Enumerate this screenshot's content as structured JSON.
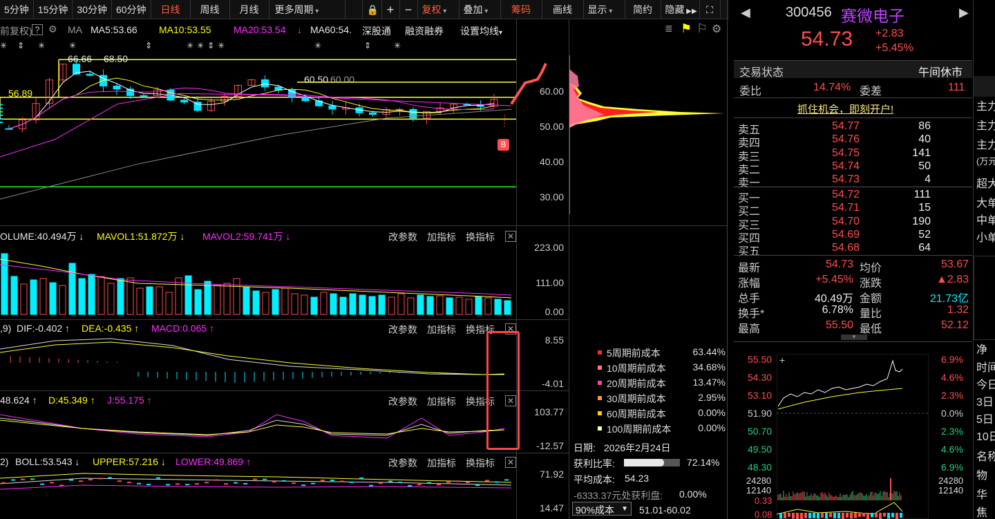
{
  "toolbar": {
    "periods": [
      "5分钟",
      "15分钟",
      "30分钟",
      "60分钟",
      "日线",
      "周线",
      "月线",
      "更多周期"
    ],
    "tools": [
      "复权",
      "叠加",
      "筹码",
      "画线",
      "显示",
      "简约",
      "隐藏"
    ]
  },
  "main": {
    "ma_prefix": "前复权)",
    "ma_label": "MA",
    "ma5": "MA5:53.66",
    "ma10": "MA10:53.55",
    "ma20": "MA20:53.54",
    "ma60": "MA60:54.",
    "link1": "深股通",
    "link2": "融资融券",
    "link3": "设置均线",
    "price_labels": {
      "p1": "66.66",
      "p2": "68.50",
      "p3": "56.89",
      "p4": "60.50",
      "p5": "60.00"
    },
    "b_marker": "B",
    "axis": [
      "60.00",
      "50.00",
      "40.00",
      "30.00"
    ]
  },
  "volume": {
    "label": "OLUME:40.494万",
    "mavol1": "MAVOL1:51.872万",
    "mavol2": "MAVOL2:59.741万",
    "axis": [
      "223.00",
      "111.00",
      "0.00"
    ]
  },
  "macd": {
    "prefix": ",9)",
    "dif": "DIF:-0.402",
    "dea": "DEA:-0.435",
    "macd": "MACD:0.065",
    "axis": [
      "8.55",
      "-4.01"
    ]
  },
  "kdj": {
    "k": "48.624",
    "d": "D:45.349",
    "j": "J:55.175",
    "axis": [
      "103.77",
      "-12.57"
    ]
  },
  "boll": {
    "prefix": "2)",
    "boll": "BOLL:53.543",
    "upper": "UPPER:57.216",
    "lower": "LOWER:49.869",
    "axis": [
      "71.92",
      "14.47"
    ]
  },
  "indicator_buttons": {
    "a": "改参数",
    "b": "加指标",
    "c": "换指标"
  },
  "cost": {
    "rows": [
      {
        "name": "5周期前成本",
        "value": "63.44%",
        "color": "#ff2b2b"
      },
      {
        "name": "10周期前成本",
        "value": "34.68%",
        "color": "#ff7a7a"
      },
      {
        "name": "20周期前成本",
        "value": "13.47%",
        "color": "#ff40b0"
      },
      {
        "name": "30周期前成本",
        "value": "2.95%",
        "color": "#ff9a2b"
      },
      {
        "name": "60周期前成本",
        "value": "0.00%",
        "color": "#ffd000"
      },
      {
        "name": "100周期前成本",
        "value": "0.00%",
        "color": "#ffffaa"
      }
    ],
    "date_label": "日期:",
    "date": "2026年2月24日",
    "profit_label": "获利比率:",
    "profit_value": "72.14%",
    "profit_fraction": 0.72,
    "avg_label": "平均成本:",
    "avg_value": "54.23",
    "note": "-6333.37元处获利盘:",
    "note_value": "0.00%",
    "select": "90%成本",
    "range": "51.01-60.02"
  },
  "quote": {
    "code": "300456",
    "name": "赛微电子",
    "price": "54.73",
    "change": "+2.83",
    "pct": "+5.45%",
    "status_label": "交易状态",
    "status": "午间休市",
    "weibi_label": "委比",
    "weibi": "14.74%",
    "weicha_label": "委差",
    "weicha": "111",
    "banner": "抓住机会，即刻开户!",
    "sell": [
      {
        "l": "卖五",
        "p": "54.77",
        "v": "86"
      },
      {
        "l": "卖四",
        "p": "54.76",
        "v": "40"
      },
      {
        "l": "卖三",
        "p": "54.75",
        "v": "141"
      },
      {
        "l": "卖二",
        "p": "54.74",
        "v": "50"
      },
      {
        "l": "卖一",
        "p": "54.73",
        "v": "4"
      }
    ],
    "buy": [
      {
        "l": "买一",
        "p": "54.72",
        "v": "111"
      },
      {
        "l": "买二",
        "p": "54.71",
        "v": "15"
      },
      {
        "l": "买三",
        "p": "54.70",
        "v": "190"
      },
      {
        "l": "买四",
        "p": "54.69",
        "v": "52"
      },
      {
        "l": "买五",
        "p": "54.68",
        "v": "64"
      }
    ],
    "stats": [
      {
        "l1": "最新",
        "v1": "54.73",
        "l2": "均价",
        "v2": "53.67",
        "c1": "red",
        "c2": "red"
      },
      {
        "l1": "涨幅",
        "v1": "+5.45%",
        "l2": "涨跌",
        "v2": "▲2.83",
        "c1": "red",
        "c2": "red"
      },
      {
        "l1": "总手",
        "v1": "40.49万",
        "l2": "金额",
        "v2": "21.73亿",
        "c1": "wht",
        "c2": "cyn"
      },
      {
        "l1": "换手*",
        "v1": "6.78%",
        "l2": "量比",
        "v2": "1.32",
        "c1": "wht",
        "c2": "red"
      },
      {
        "l1": "最高",
        "v1": "55.50",
        "l2": "最低",
        "v2": "52.12",
        "c1": "red",
        "c2": "red"
      }
    ],
    "mini_left": [
      "55.50",
      "54.30",
      "53.10",
      "51.90",
      "50.70",
      "49.50",
      "48.30"
    ],
    "mini_right": [
      "6.9%",
      "4.6%",
      "2.3%",
      "0.0%",
      "2.3%",
      "4.6%",
      "6.9%"
    ],
    "mini_vol": [
      "24280",
      "12140",
      "24280",
      "12140"
    ],
    "mini_macd": [
      "0.33",
      "0.08"
    ]
  },
  "far_right": {
    "items": [
      "主力",
      "主力",
      "主力",
      "(万元",
      "超大",
      "大单",
      "中单",
      "小单",
      "净",
      "时间",
      "今日",
      "3日",
      "5日",
      "10日",
      "名称",
      "物",
      "华",
      "焦"
    ]
  }
}
